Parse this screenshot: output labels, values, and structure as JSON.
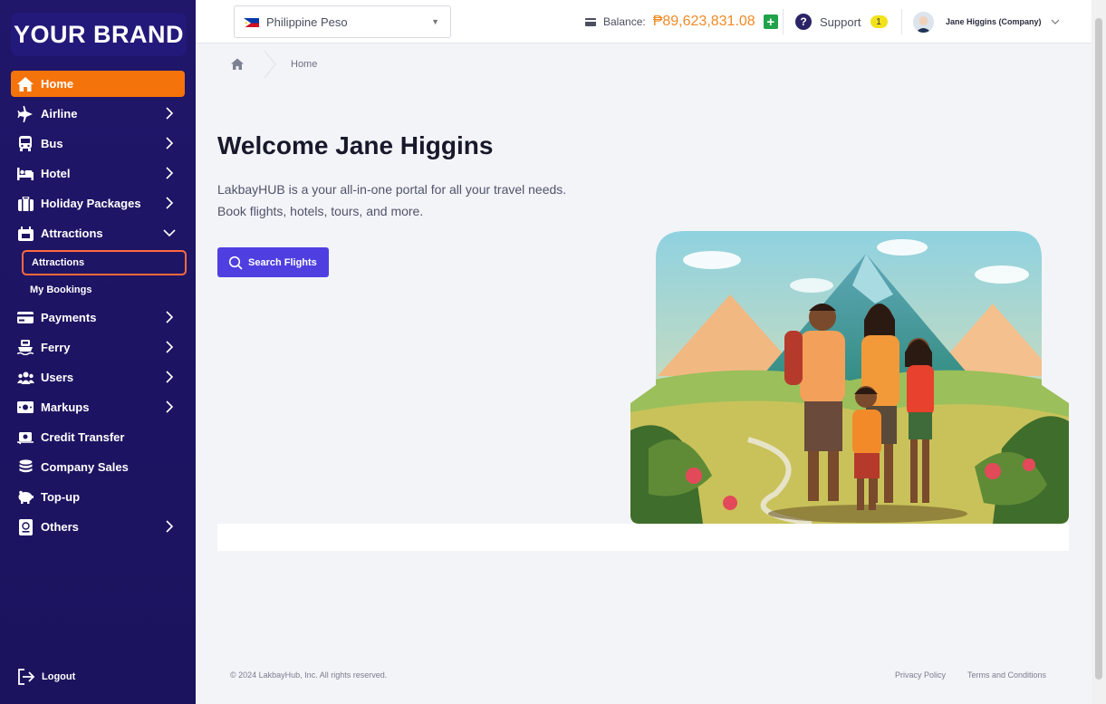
{
  "brand": {
    "name": "YOUR BRAND"
  },
  "sidebar": {
    "items": [
      {
        "label": "Home",
        "icon": "home-icon"
      },
      {
        "label": "Airline",
        "icon": "airplane-icon"
      },
      {
        "label": "Bus",
        "icon": "bus-icon"
      },
      {
        "label": "Hotel",
        "icon": "bed-icon"
      },
      {
        "label": "Holiday Packages",
        "icon": "suitcase-icon"
      },
      {
        "label": "Attractions",
        "icon": "ticket-icon"
      },
      {
        "label": "Payments",
        "icon": "credit-card-icon"
      },
      {
        "label": "Ferry",
        "icon": "ferry-icon"
      },
      {
        "label": "Users",
        "icon": "users-icon"
      },
      {
        "label": "Markups",
        "icon": "money-icon"
      },
      {
        "label": "Credit Transfer",
        "icon": "transfer-icon"
      },
      {
        "label": "Company Sales",
        "icon": "coins-icon"
      },
      {
        "label": "Top-up",
        "icon": "piggy-bank-icon"
      },
      {
        "label": "Others",
        "icon": "passport-icon"
      }
    ],
    "attractions_sub": [
      "Attractions",
      "My Bookings"
    ],
    "logout": "Logout"
  },
  "header": {
    "currency": "Philippine Peso",
    "balance_label": "Balance:",
    "balance_amount": "₱89,623,831.08",
    "support_label": "Support",
    "support_count": "1",
    "user_name": "Jane Higgins (Company)"
  },
  "breadcrumb": {
    "current": "Home"
  },
  "main": {
    "welcome": "Welcome Jane Higgins",
    "desc_line1": "LakbayHUB is a your all-in-one portal for all your travel needs.",
    "desc_line2": "Book flights, hotels, tours, and more.",
    "search_button": "Search Flights"
  },
  "footer": {
    "copyright": "© 2024 LakbayHub, Inc. All rights reserved.",
    "privacy": "Privacy Policy",
    "terms": "Terms and Conditions"
  },
  "colors": {
    "accent": "#f5730b",
    "primary": "#4f3fe0",
    "sidebar": "#1c1462",
    "balance": "#f08a24"
  }
}
